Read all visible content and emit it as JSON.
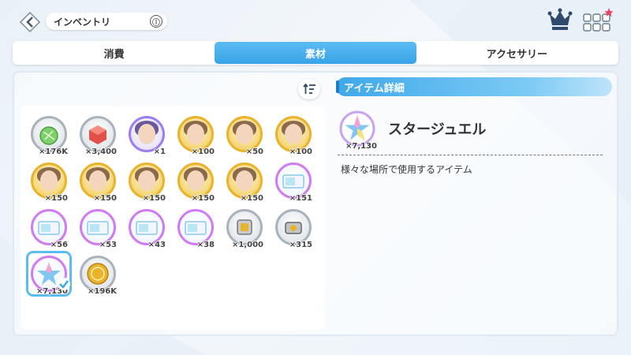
{
  "header": {
    "title": "インベントリ",
    "info_icon": "ⓘ",
    "back_icon": "back-icon",
    "crown_icon": "crown-icon",
    "menu_icon": "grid-menu-icon"
  },
  "tabs": [
    {
      "label": "消費",
      "active": false
    },
    {
      "label": "素材",
      "active": true
    },
    {
      "label": "アクセサリー",
      "active": false
    }
  ],
  "sort_icon": "sort-icon",
  "items": [
    {
      "kind": "melon",
      "count": "×176K"
    },
    {
      "kind": "cube",
      "count": "×3,400"
    },
    {
      "kind": "char-purple",
      "count": "×1"
    },
    {
      "kind": "char-gold",
      "count": "×100"
    },
    {
      "kind": "char-gold",
      "count": "×50"
    },
    {
      "kind": "char-gold",
      "count": "×100"
    },
    {
      "kind": "char-gold",
      "count": "×150"
    },
    {
      "kind": "char-gold",
      "count": "×150"
    },
    {
      "kind": "char-gold",
      "count": "×150"
    },
    {
      "kind": "char-gold",
      "count": "×150"
    },
    {
      "kind": "char-gold",
      "count": "×150"
    },
    {
      "kind": "ticket",
      "count": "×151"
    },
    {
      "kind": "ticket",
      "count": "×56"
    },
    {
      "kind": "ticket",
      "count": "×53"
    },
    {
      "kind": "ticket",
      "count": "×43"
    },
    {
      "kind": "ticket",
      "count": "×38"
    },
    {
      "kind": "chip",
      "count": "×1,000"
    },
    {
      "kind": "camera",
      "count": "×315"
    },
    {
      "kind": "jewel",
      "count": "×7,130",
      "selected": true
    },
    {
      "kind": "coin",
      "count": "×196K"
    }
  ],
  "detail": {
    "header": "アイテム詳細",
    "name": "スタージュエル",
    "count": "×7,130",
    "description": "様々な場所で使用するアイテム"
  },
  "colors": {
    "accent": "#3fa8ea",
    "gold": "#e9b42b",
    "purple": "#9c7ef2"
  }
}
